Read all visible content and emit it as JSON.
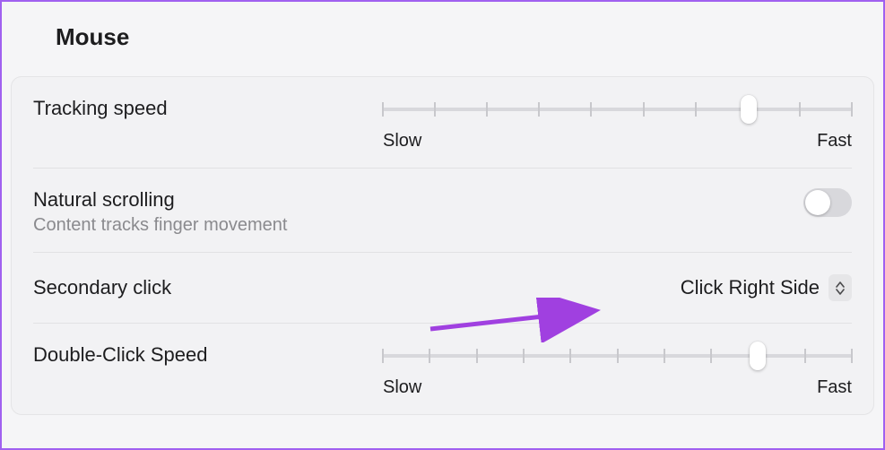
{
  "title": "Mouse",
  "settings": {
    "tracking": {
      "label": "Tracking speed",
      "min_label": "Slow",
      "max_label": "Fast",
      "ticks": 10,
      "value_percent": 78
    },
    "natural_scrolling": {
      "label": "Natural scrolling",
      "description": "Content tracks finger movement",
      "enabled": false
    },
    "secondary_click": {
      "label": "Secondary click",
      "selected": "Click Right Side"
    },
    "double_click": {
      "label": "Double-Click Speed",
      "min_label": "Slow",
      "max_label": "Fast",
      "ticks": 11,
      "value_percent": 80
    }
  },
  "annotation": {
    "arrow_color": "#a040e0"
  }
}
